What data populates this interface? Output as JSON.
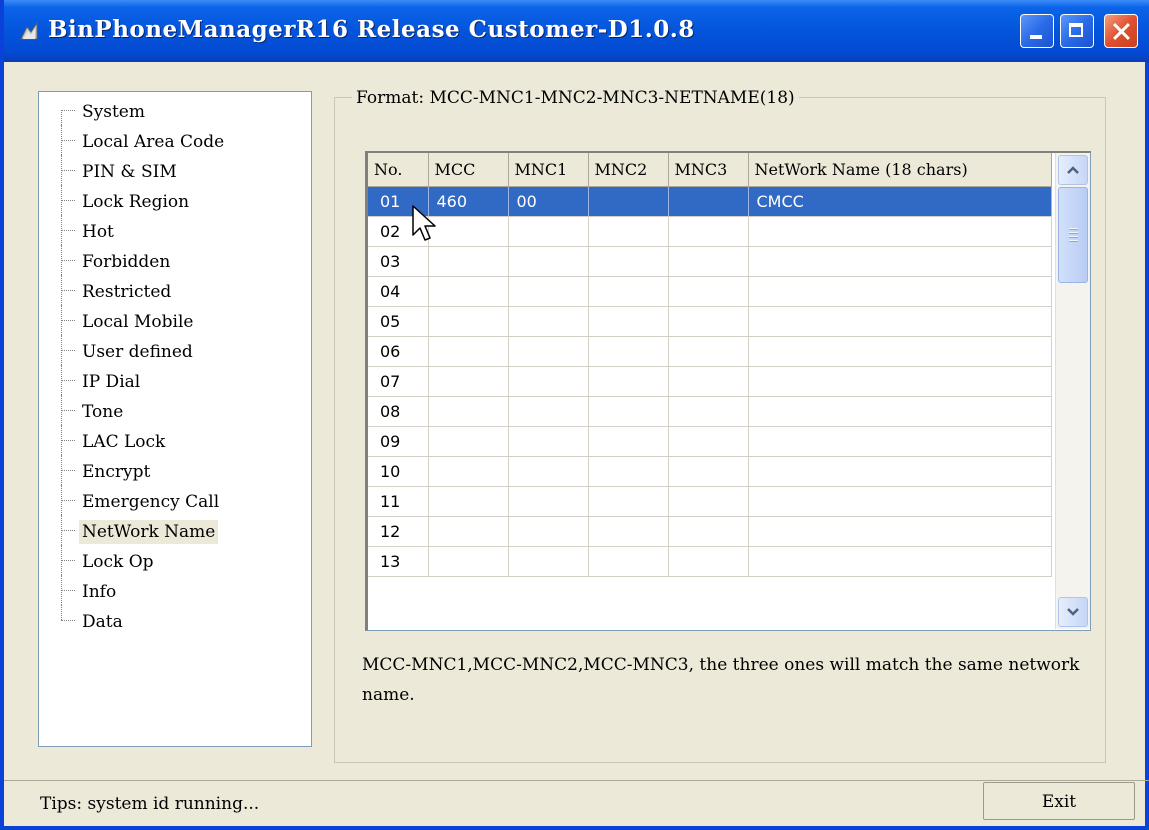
{
  "window": {
    "title": "BinPhoneManagerR16 Release Customer-D1.0.8"
  },
  "tree": {
    "items": [
      {
        "label": "System"
      },
      {
        "label": "Local Area Code"
      },
      {
        "label": "PIN & SIM"
      },
      {
        "label": "Lock Region"
      },
      {
        "label": "Hot"
      },
      {
        "label": "Forbidden"
      },
      {
        "label": "Restricted"
      },
      {
        "label": "Local Mobile"
      },
      {
        "label": "User defined"
      },
      {
        "label": "IP Dial"
      },
      {
        "label": "Tone"
      },
      {
        "label": "LAC Lock"
      },
      {
        "label": "Encrypt"
      },
      {
        "label": "Emergency Call"
      },
      {
        "label": "NetWork Name",
        "selected": true
      },
      {
        "label": "Lock Op"
      },
      {
        "label": "Info"
      },
      {
        "label": "Data"
      }
    ]
  },
  "group": {
    "legend": "Format: MCC-MNC1-MNC2-MNC3-NETNAME(18)"
  },
  "table": {
    "columns": [
      "No.",
      "MCC",
      "MNC1",
      "MNC2",
      "MNC3",
      "NetWork Name (18 chars)"
    ],
    "rows": [
      {
        "no": "01",
        "mcc": "460",
        "mnc1": "00",
        "mnc2": "",
        "mnc3": "",
        "name": "CMCC",
        "selected": true
      },
      {
        "no": "02",
        "mcc": "",
        "mnc1": "",
        "mnc2": "",
        "mnc3": "",
        "name": ""
      },
      {
        "no": "03",
        "mcc": "",
        "mnc1": "",
        "mnc2": "",
        "mnc3": "",
        "name": ""
      },
      {
        "no": "04",
        "mcc": "",
        "mnc1": "",
        "mnc2": "",
        "mnc3": "",
        "name": ""
      },
      {
        "no": "05",
        "mcc": "",
        "mnc1": "",
        "mnc2": "",
        "mnc3": "",
        "name": ""
      },
      {
        "no": "06",
        "mcc": "",
        "mnc1": "",
        "mnc2": "",
        "mnc3": "",
        "name": ""
      },
      {
        "no": "07",
        "mcc": "",
        "mnc1": "",
        "mnc2": "",
        "mnc3": "",
        "name": ""
      },
      {
        "no": "08",
        "mcc": "",
        "mnc1": "",
        "mnc2": "",
        "mnc3": "",
        "name": ""
      },
      {
        "no": "09",
        "mcc": "",
        "mnc1": "",
        "mnc2": "",
        "mnc3": "",
        "name": ""
      },
      {
        "no": "10",
        "mcc": "",
        "mnc1": "",
        "mnc2": "",
        "mnc3": "",
        "name": ""
      },
      {
        "no": "11",
        "mcc": "",
        "mnc1": "",
        "mnc2": "",
        "mnc3": "",
        "name": ""
      },
      {
        "no": "12",
        "mcc": "",
        "mnc1": "",
        "mnc2": "",
        "mnc3": "",
        "name": ""
      },
      {
        "no": "13",
        "mcc": "",
        "mnc1": "",
        "mnc2": "",
        "mnc3": "",
        "name": ""
      }
    ]
  },
  "note": "MCC-MNC1,MCC-MNC2,MCC-MNC3, the three ones will match the same network name.",
  "status": {
    "tips": "Tips: system id running..."
  },
  "buttons": {
    "exit": "Exit"
  },
  "colors": {
    "titlebar": "#0454DC",
    "selection": "#316AC5",
    "face": "#ECE9D8"
  }
}
